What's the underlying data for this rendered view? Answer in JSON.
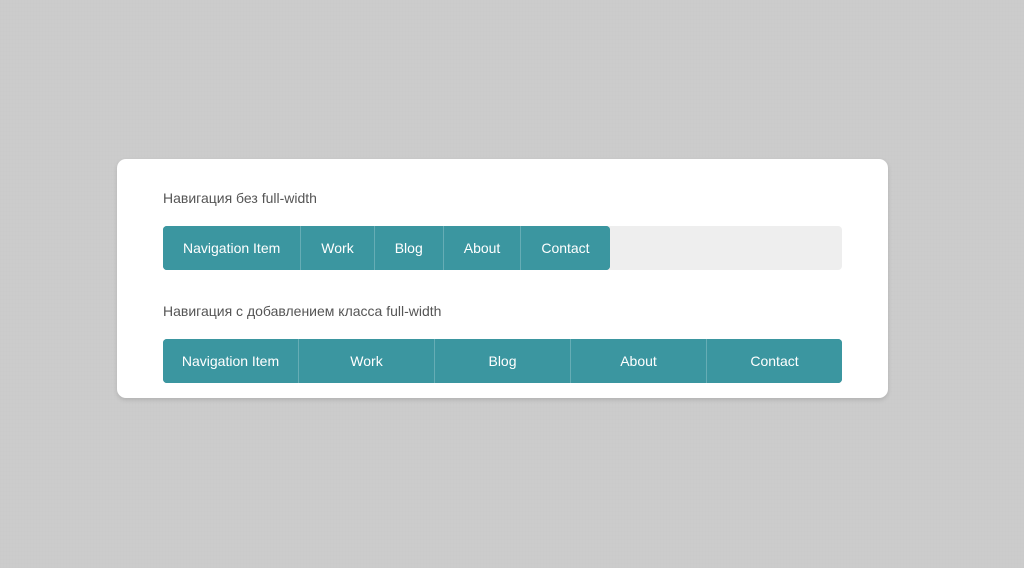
{
  "colors": {
    "page_background": "#cccccc",
    "card_background": "#ffffff",
    "nav_track": "#eeeeee",
    "nav_item": "#3b96a0",
    "nav_item_text": "#ffffff",
    "heading_text": "#555555"
  },
  "card": {
    "sections": [
      {
        "title": "Навигация без full-width",
        "nav": {
          "full_width": false,
          "items": [
            {
              "label": "Navigation Item"
            },
            {
              "label": "Work"
            },
            {
              "label": "Blog"
            },
            {
              "label": "About"
            },
            {
              "label": "Contact"
            }
          ]
        }
      },
      {
        "title": "Навигация с добавлением класса full-width",
        "nav": {
          "full_width": true,
          "items": [
            {
              "label": "Navigation Item"
            },
            {
              "label": "Work"
            },
            {
              "label": "Blog"
            },
            {
              "label": "About"
            },
            {
              "label": "Contact"
            }
          ]
        }
      }
    ]
  }
}
